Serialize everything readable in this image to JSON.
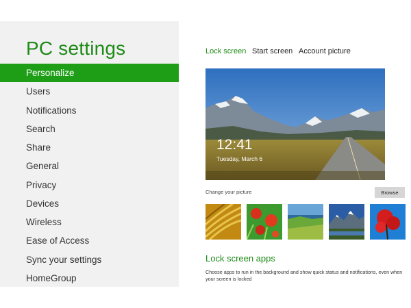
{
  "sidebar": {
    "title": "PC settings",
    "items": [
      {
        "label": "Personalize",
        "active": true
      },
      {
        "label": "Users"
      },
      {
        "label": "Notifications"
      },
      {
        "label": "Search"
      },
      {
        "label": "Share"
      },
      {
        "label": "General"
      },
      {
        "label": "Privacy"
      },
      {
        "label": "Devices"
      },
      {
        "label": "Wireless"
      },
      {
        "label": "Ease of Access"
      },
      {
        "label": "Sync your settings"
      },
      {
        "label": "HomeGroup"
      }
    ]
  },
  "tabs": [
    {
      "label": "Lock screen",
      "active": true
    },
    {
      "label": "Start screen"
    },
    {
      "label": "Account picture"
    }
  ],
  "lock_preview": {
    "time": "12:41",
    "date": "Tuesday, March 6"
  },
  "picture": {
    "change_label": "Change your picture",
    "browse_label": "Browse",
    "thumbnails": [
      "wheat-grass",
      "red-flowers",
      "green-coast",
      "mountain-lake",
      "red-tree"
    ]
  },
  "lock_screen_apps": {
    "title": "Lock screen apps",
    "description": "Choose apps to run in the background and show quick status and notifications, even when your screen is locked"
  },
  "colors": {
    "accent": "#1e9e17",
    "accent_text": "#1e8a17",
    "sidebar_bg": "#f1f1f1"
  }
}
